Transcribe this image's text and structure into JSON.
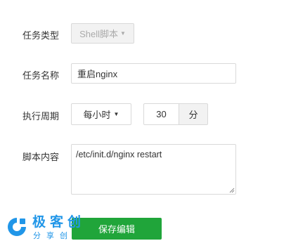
{
  "form": {
    "task_type_label": "任务类型",
    "task_type_value": "Shell脚本",
    "task_name_label": "任务名称",
    "task_name_value": "重启nginx",
    "period_label": "执行周期",
    "period_value": "每小时",
    "minute_value": "30",
    "minute_unit": "分",
    "script_label": "脚本内容",
    "script_value": "/etc/init.d/nginx restart",
    "save_label": "保存编辑"
  },
  "watermark": {
    "title": "极客创",
    "subtitle": "分享创",
    "color": "#2196e8"
  },
  "colors": {
    "accent": "#20a53a"
  },
  "icons": {
    "dropdown": "caret-down-icon",
    "resize": "resize-grip-icon",
    "logo": "brand-logo-icon"
  }
}
